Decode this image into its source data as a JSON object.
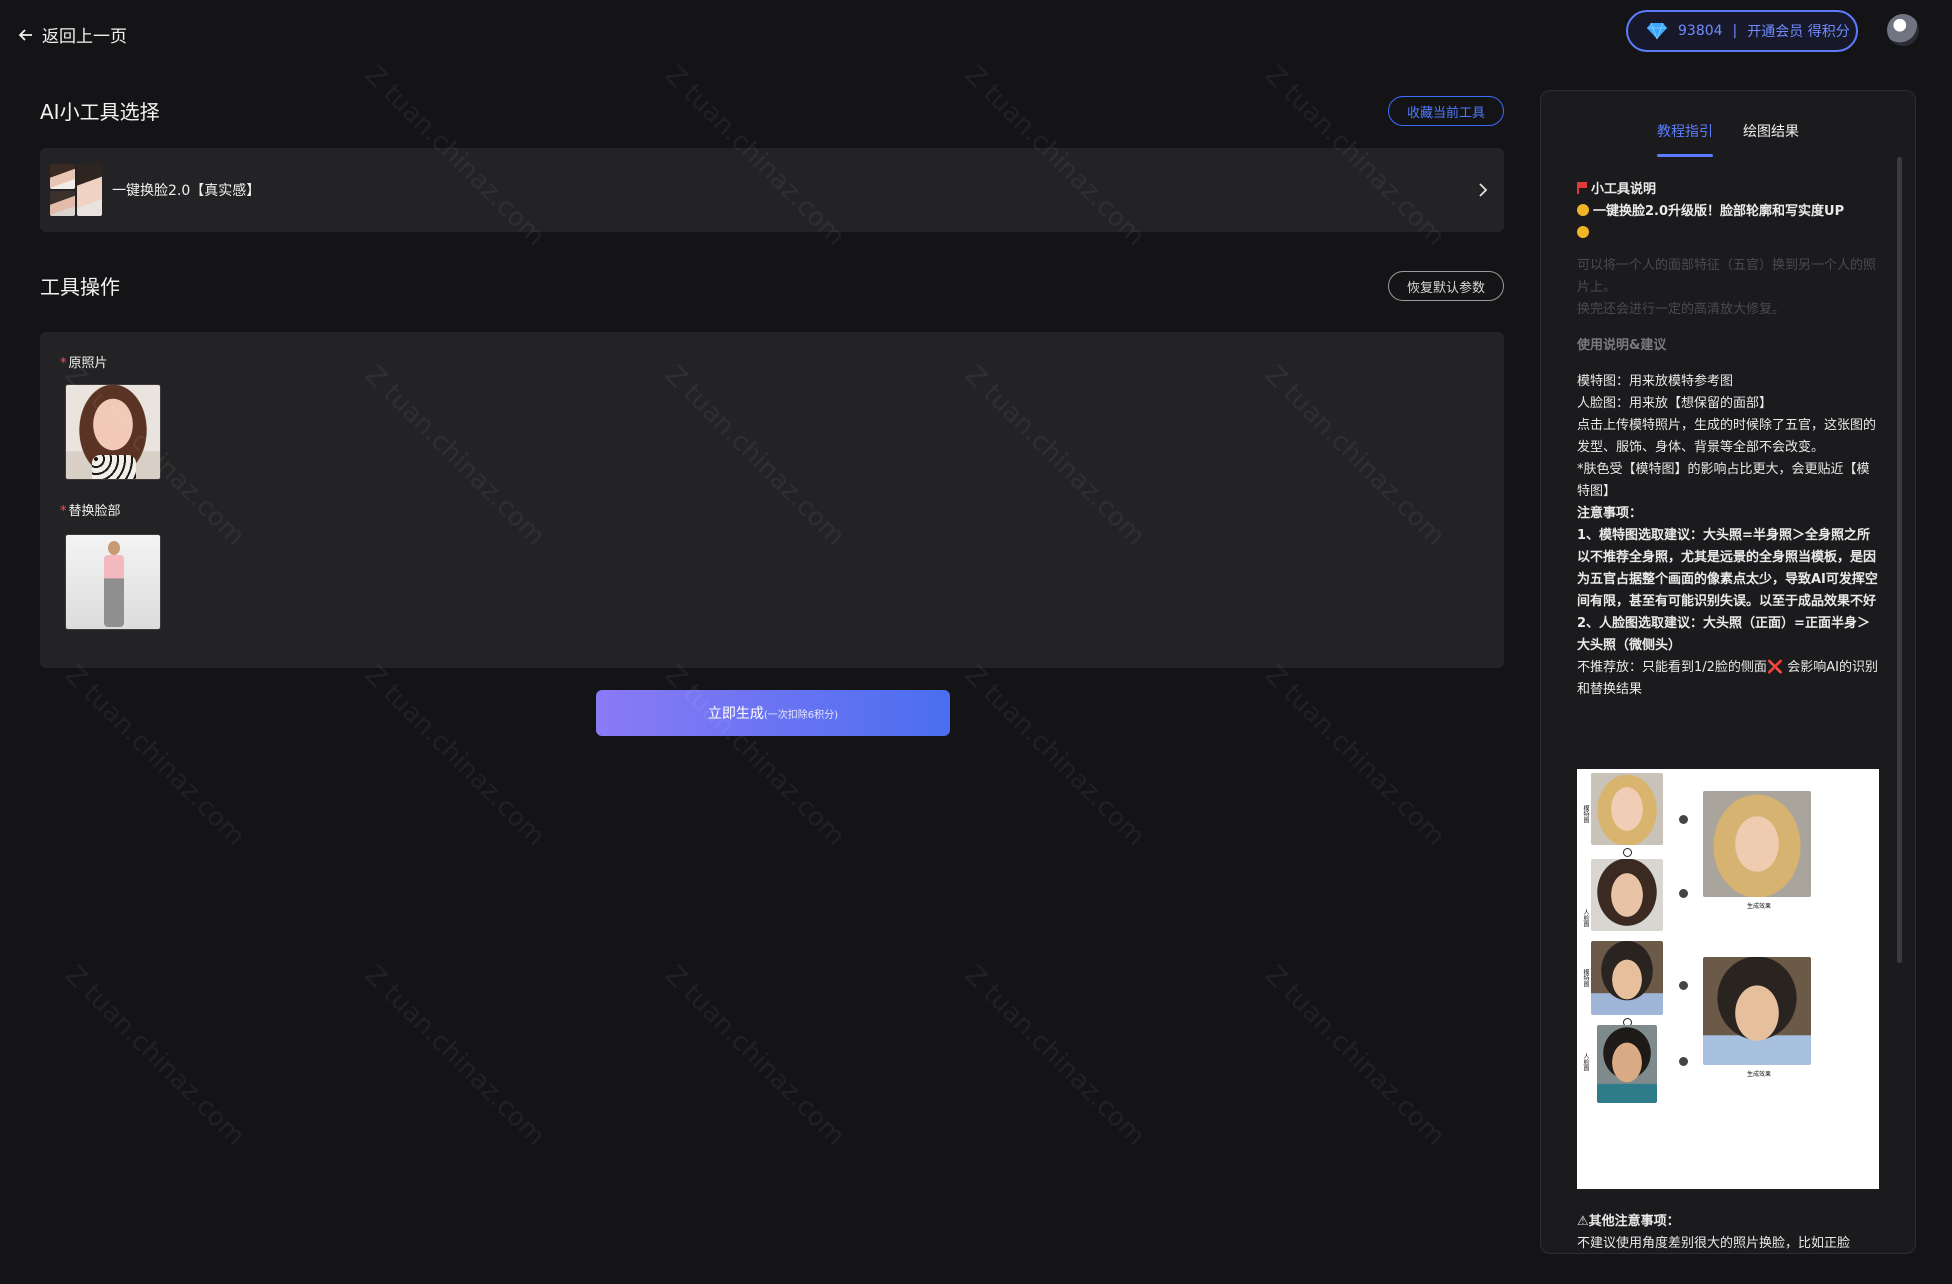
{
  "header": {
    "back_label": "返回上一页",
    "points": "93804",
    "member_label": "开通会员 得积分",
    "separator": "|"
  },
  "tool_select": {
    "title": "AI小工具选择",
    "favorite_button": "收藏当前工具",
    "current_tool": "一键换脸2.0【真实感】"
  },
  "tool_ops": {
    "title": "工具操作",
    "reset_button": "恢复默认参数",
    "field_original": "原照片",
    "field_face": "替换脸部",
    "required_mark": "*"
  },
  "generate": {
    "label": "立即生成",
    "cost": "(一次扣除6积分)"
  },
  "side_panel": {
    "tabs": [
      "教程指引",
      "绘图结果"
    ],
    "active_tab": 0,
    "doc": {
      "heading": "小工具说明",
      "subheading": "一键换脸2.0升级版！脸部轮廓和写实度UP",
      "intro_1": "可以将一个人的面部特征（五官）换到另一个人的照片上。",
      "intro_2": "换完还会进行一定的高清放大修复。",
      "usage_title": "使用说明&建议",
      "usage_1": "模特图：用来放模特参考图",
      "usage_2": "人脸图：用来放【想保留的面部】",
      "usage_3": "点击上传模特照片，生成的时候除了五官，这张图的发型、服饰、身体、背景等全部不会改变。",
      "usage_4": "*肤色受【模特图】的影响占比更大，会更贴近【模特图】",
      "notes_title": "注意事项：",
      "note_1": "1、模特图选取建议：大头照=半身照＞全身照之所以不推荐全身照，尤其是远景的全身照当模板，是因为五官占据整个画面的像素点太少，导致AI可发挥空间有限，甚至有可能识别失误。以至于成品效果不好",
      "note_2": "2、人脸图选取建议：大头照（正面）=正面半身＞大头照（微侧头）",
      "note_3a": "不推荐放：只能看到1/2脸的侧面",
      "note_3x": "❌",
      "note_3b": " 会影响AI的识别和替换结果",
      "other_title": "⚠其他注意事项：",
      "other_1": "不建议使用角度差别很大的照片换脸，比如正脸"
    },
    "example": {
      "label_model": "模特图",
      "label_face": "人脸图",
      "label_result": "生成效果"
    }
  },
  "watermark": "Z tuan.chinaz.com",
  "colors": {
    "accent": "#5b7cff",
    "background": "#141416",
    "panel": "#232325",
    "required": "#ff4d4f"
  }
}
